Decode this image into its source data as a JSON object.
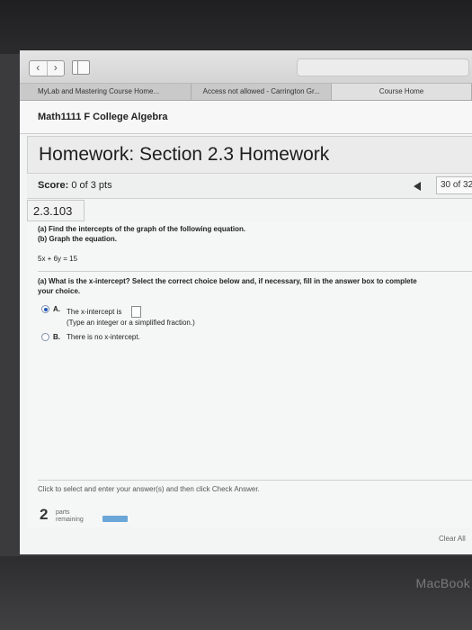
{
  "browser": {
    "tabs": [
      {
        "label": "MyLab and Mastering Course Home..."
      },
      {
        "label": "Access not allowed - Carrington Gr..."
      },
      {
        "label": "Course Home"
      }
    ]
  },
  "course": {
    "title": "Math1111 F College Algebra"
  },
  "homework": {
    "title": "Homework: Section 2.3 Homework",
    "score_label": "Score:",
    "score_value": "0 of 3 pts",
    "question_count": "30 of 32",
    "question_number": "2.3.103"
  },
  "question": {
    "part_a_prompt": "(a) Find the intercepts of the graph of the following equation.",
    "part_b_prompt": "(b) Graph the equation.",
    "equation": "5x + 6y = 15",
    "sub_question_line1": "(a) What is the x-intercept? Select the correct choice below and, if necessary, fill in the answer box to complete",
    "sub_question_line2": "your choice.",
    "choice_a_letter": "A.",
    "choice_a_text": "The x-intercept is",
    "choice_a_hint": "(Type an integer or a simplified fraction.)",
    "choice_a_answer": "",
    "choice_b_letter": "B.",
    "choice_b_text": "There is no x-intercept.",
    "selected_choice": "A"
  },
  "footer": {
    "instruction": "Click to select and enter your answer(s) and then click Check Answer.",
    "parts_count": "2",
    "parts_label_1": "parts",
    "parts_label_2": "remaining",
    "clear_label": "Clear All"
  },
  "device": {
    "label": "MacBook"
  },
  "colors": {
    "accent": "#1c58b5",
    "progress": "#6aa6d8"
  }
}
